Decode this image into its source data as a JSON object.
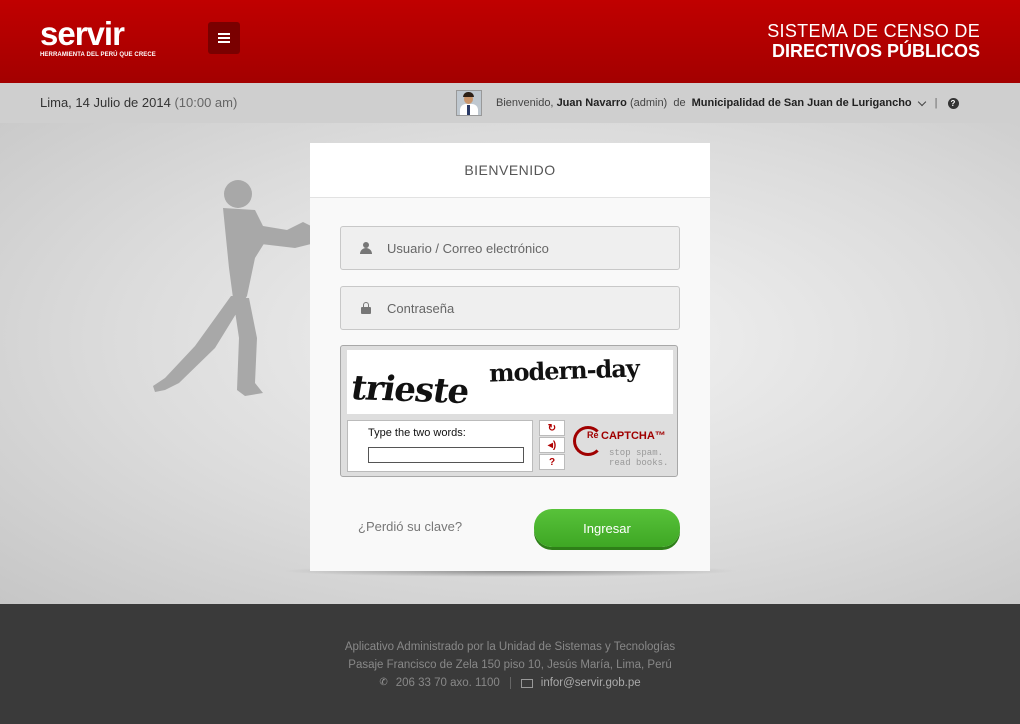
{
  "header": {
    "logo_text": "servir",
    "logo_tagline": "HERRAMIENTA DEL PERÚ QUE CRECE",
    "system_title_line1": "SISTEMA DE CENSO  DE",
    "system_title_line2": "DIRECTIVOS PÚBLICOS",
    "brand_color": "#b00000"
  },
  "subbar": {
    "date": "Lima, 14 Julio de 2014",
    "time": "(10:00 am)",
    "welcome_prefix": "Bienvenido,",
    "user_name": "Juan Navarro",
    "user_role": "(admin)",
    "of_label": "de",
    "organization": "Municipalidad de San Juan de Lurigancho",
    "separator": "|",
    "help_glyph": "?"
  },
  "login": {
    "title": "BIENVENIDO",
    "username_placeholder": "Usuario / Correo electrónico",
    "password_placeholder": "Contraseña",
    "forgot_label": "¿Perdió su clave?",
    "submit_label": "Ingresar",
    "submit_color": "#4cb52f"
  },
  "captcha": {
    "word1": "trieste",
    "word2": "modern-day",
    "prompt": "Type the two words:",
    "brand_re": "Re",
    "brand_name": "CAPTCHA™",
    "tagline": "stop spam. read books.",
    "btn_refresh": "↻",
    "btn_audio": "◂)",
    "btn_help": "?"
  },
  "footer": {
    "line1": "Aplicativo Administrado por la Unidad de Sistemas y Tecnologías",
    "line2": "Pasaje Francisco de Zela 150 piso 10, Jesús María, Lima, Perú",
    "phone": "206 33 70 axo. 1100",
    "email": "infor@servir.gob.pe"
  }
}
